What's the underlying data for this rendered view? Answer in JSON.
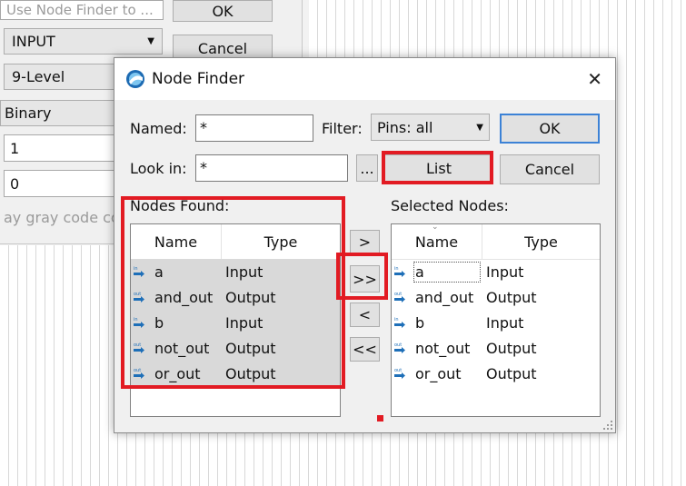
{
  "background_window": {
    "node_finder_placeholder": "Use Node Finder to ...",
    "ok_label": "OK",
    "cancel_label": "Cancel",
    "direction_value": "INPUT",
    "level_value": "9-Level",
    "radix_value": "Binary",
    "value_one": "1",
    "value_zero": "0",
    "gray_code_text": "ay gray code co"
  },
  "dialog": {
    "title": "Node Finder",
    "named_label": "Named:",
    "named_value": "*",
    "filter_label": "Filter:",
    "filter_value": "Pins: all",
    "ok_label": "OK",
    "look_in_label": "Look in:",
    "look_in_value": "*",
    "browse_label": "...",
    "list_label": "List",
    "cancel_label": "Cancel",
    "nodes_found_label": "Nodes Found:",
    "selected_nodes_label": "Selected Nodes:",
    "columns": {
      "name": "Name",
      "type": "Type"
    },
    "nodes_found": [
      {
        "pin": "in",
        "name": "a",
        "type": "Input"
      },
      {
        "pin": "out",
        "name": "and_out",
        "type": "Output"
      },
      {
        "pin": "in",
        "name": "b",
        "type": "Input"
      },
      {
        "pin": "out",
        "name": "not_out",
        "type": "Output"
      },
      {
        "pin": "out",
        "name": "or_out",
        "type": "Output"
      }
    ],
    "selected_nodes": [
      {
        "pin": "in",
        "name": "a",
        "type": "Input"
      },
      {
        "pin": "out",
        "name": "and_out",
        "type": "Output"
      },
      {
        "pin": "in",
        "name": "b",
        "type": "Input"
      },
      {
        "pin": "out",
        "name": "not_out",
        "type": "Output"
      },
      {
        "pin": "out",
        "name": "or_out",
        "type": "Output"
      }
    ],
    "transfer_buttons": {
      "add": ">",
      "add_all": ">>",
      "remove": "<",
      "remove_all": "<<"
    }
  },
  "colors": {
    "highlight": "#e21b23",
    "selection": "#d9d9d9",
    "pin_icon": "#1e6fb8",
    "default_button_border": "#3c82d6"
  }
}
